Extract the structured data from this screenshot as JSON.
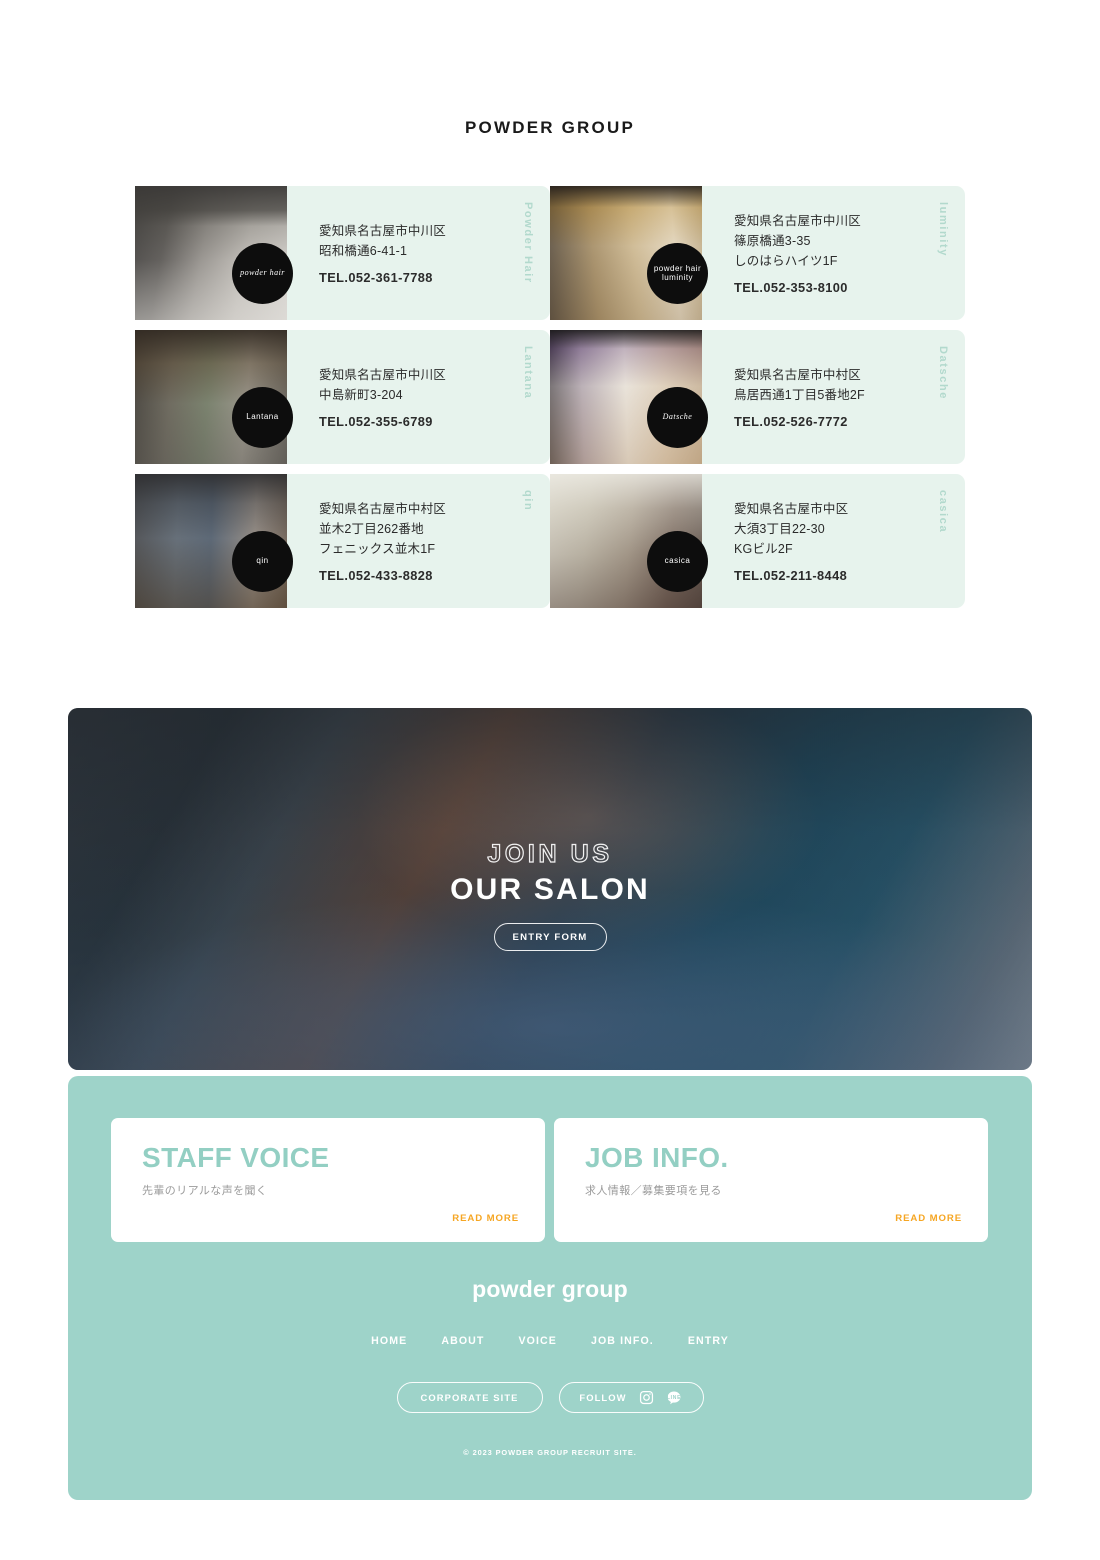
{
  "group": {
    "title": "POWDER GROUP",
    "salons": [
      {
        "name": "Powder Hair",
        "logo_text": "powder hair",
        "address1": "愛知県名古屋市中川区",
        "address2": "昭和橋通6-41-1",
        "address3": "",
        "tel": "TEL.052-361-7788"
      },
      {
        "name": "luminity",
        "logo_text": "powder hair luminity",
        "address1": "愛知県名古屋市中川区",
        "address2": "篠原橋通3-35",
        "address3": "しのはらハイツ1F",
        "tel": "TEL.052-353-8100"
      },
      {
        "name": "Lantana",
        "logo_text": "Lantana",
        "address1": "愛知県名古屋市中川区",
        "address2": "中島新町3-204",
        "address3": "",
        "tel": "TEL.052-355-6789"
      },
      {
        "name": "Datsche",
        "logo_text": "Datsche",
        "address1": "愛知県名古屋市中村区",
        "address2": "鳥居西通1丁目5番地2F",
        "address3": "",
        "tel": "TEL.052-526-7772"
      },
      {
        "name": "qin",
        "logo_text": "qin",
        "address1": "愛知県名古屋市中村区",
        "address2": "並木2丁目262番地",
        "address3": "フェニックス並木1F",
        "tel": "TEL.052-433-8828"
      },
      {
        "name": "casica",
        "logo_text": "casica",
        "address1": "愛知県名古屋市中区",
        "address2": "大須3丁目22-30",
        "address3": "KGビル2F",
        "tel": "TEL.052-211-8448"
      }
    ]
  },
  "hero": {
    "eyebrow": "JOIN US",
    "headline": "OUR SALON",
    "cta_label": "ENTRY FORM"
  },
  "link_cards": [
    {
      "title": "STAFF VOICE",
      "subtitle": "先輩のリアルな声を聞く",
      "read_more": "READ MORE"
    },
    {
      "title": "JOB INFO.",
      "subtitle": "求人情報／募集要項を見る",
      "read_more": "READ MORE"
    }
  ],
  "footer": {
    "logo": "powder group",
    "nav": [
      {
        "label": "HOME"
      },
      {
        "label": "ABOUT"
      },
      {
        "label": "VOICE"
      },
      {
        "label": "JOB INFO."
      },
      {
        "label": "ENTRY"
      }
    ],
    "corporate_label": "CORPORATE SITE",
    "follow_label": "FOLLOW",
    "copyright": "© 2023 POWDER GROUP RECRUIT SITE."
  },
  "colors": {
    "card_bg": "#e7f3ed",
    "teal": "#9ed3c9",
    "mint_text": "#93cfc3",
    "vertical_label": "#b2d9cd",
    "accent_orange": "#f6a623",
    "ink": "#1a1a1a"
  }
}
